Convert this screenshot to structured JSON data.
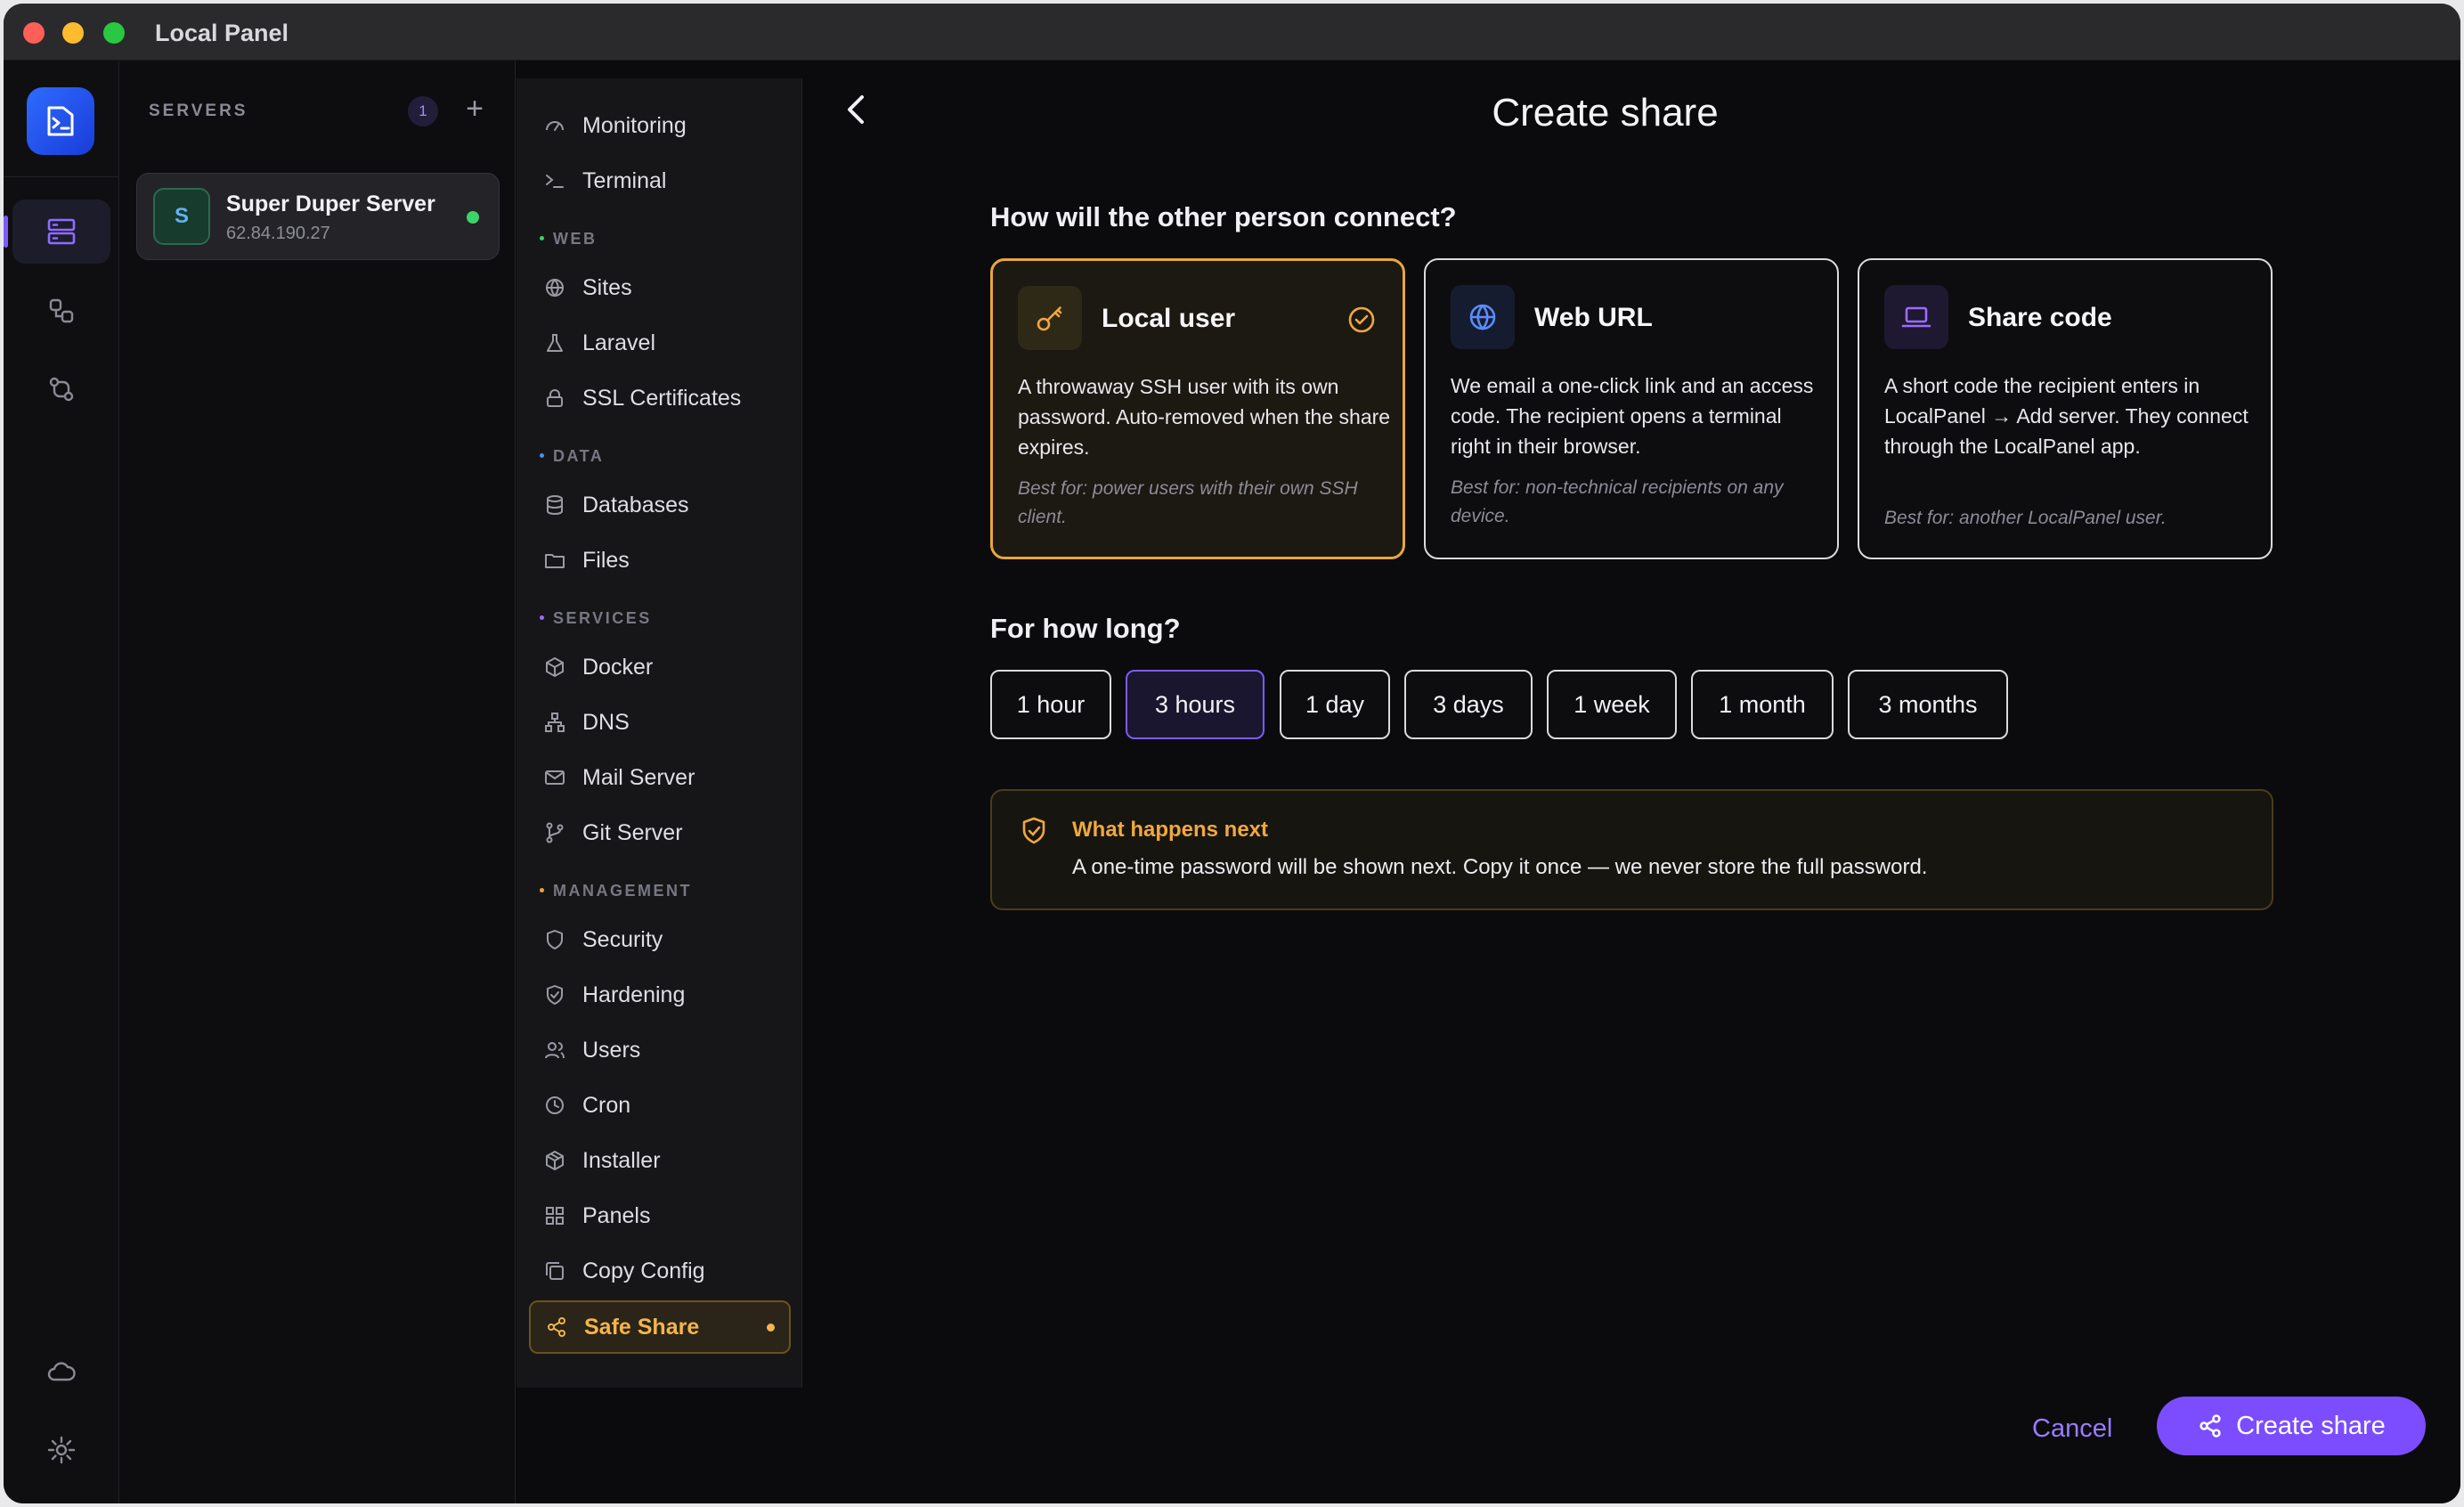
{
  "window": {
    "title": "Local Panel"
  },
  "servers": {
    "label": "SERVERS",
    "count": "1",
    "add_symbol": "+",
    "items": [
      {
        "initial": "S",
        "name": "Super Duper Server",
        "ip": "62.84.190.27",
        "status": "online"
      }
    ]
  },
  "nav": {
    "top": [
      {
        "label": "Monitoring",
        "icon": "gauge-icon"
      },
      {
        "label": "Terminal",
        "icon": "terminal-icon"
      }
    ],
    "sections": [
      {
        "title": "WEB",
        "items": [
          {
            "label": "Sites",
            "icon": "globe-icon"
          },
          {
            "label": "Laravel",
            "icon": "flask-icon"
          },
          {
            "label": "SSL Certificates",
            "icon": "lock-icon"
          }
        ]
      },
      {
        "title": "DATA",
        "items": [
          {
            "label": "Databases",
            "icon": "database-icon"
          },
          {
            "label": "Files",
            "icon": "folder-icon"
          }
        ]
      },
      {
        "title": "SERVICES",
        "items": [
          {
            "label": "Docker",
            "icon": "box-icon"
          },
          {
            "label": "DNS",
            "icon": "network-icon"
          },
          {
            "label": "Mail Server",
            "icon": "mail-icon"
          },
          {
            "label": "Git Server",
            "icon": "git-branch-icon"
          }
        ]
      },
      {
        "title": "MANAGEMENT",
        "items": [
          {
            "label": "Security",
            "icon": "shield-icon"
          },
          {
            "label": "Hardening",
            "icon": "shield-check-icon"
          },
          {
            "label": "Users",
            "icon": "users-icon"
          },
          {
            "label": "Cron",
            "icon": "clock-icon"
          },
          {
            "label": "Installer",
            "icon": "package-icon"
          },
          {
            "label": "Panels",
            "icon": "grid-icon"
          },
          {
            "label": "Copy Config",
            "icon": "copy-icon"
          },
          {
            "label": "Safe Share",
            "icon": "share-icon",
            "active": true
          }
        ]
      }
    ]
  },
  "main": {
    "title": "Create share",
    "question_connect": "How will the other person connect?",
    "options": [
      {
        "title": "Local user",
        "icon": "key-icon",
        "selected": true,
        "description": "A throwaway SSH user with its own password. Auto-removed when the share expires.",
        "best_for": "Best for: power users with their own SSH client."
      },
      {
        "title": "Web URL",
        "icon": "globe-icon",
        "selected": false,
        "description": "We email a one-click link and an access code. The recipient opens a terminal right in their browser.",
        "best_for": "Best for: non-technical recipients on any device."
      },
      {
        "title": "Share code",
        "icon": "laptop-icon",
        "selected": false,
        "description": "A short code the recipient enters in LocalPanel → Add server. They connect through the LocalPanel app.",
        "best_for": "Best for: another LocalPanel user."
      }
    ],
    "question_duration": "For how long?",
    "durations": [
      "1 hour",
      "3 hours",
      "1 day",
      "3 days",
      "1 week",
      "1 month",
      "3 months"
    ],
    "selected_duration": "3 hours",
    "info": {
      "title": "What happens next",
      "text": "A one-time password will be shown next. Copy it once — we never store the full password."
    },
    "cancel_label": "Cancel",
    "create_label": "Create share"
  },
  "colors": {
    "accent": "#7c4dff",
    "selected_option": "#e8a83a",
    "online": "#3ad46a"
  }
}
